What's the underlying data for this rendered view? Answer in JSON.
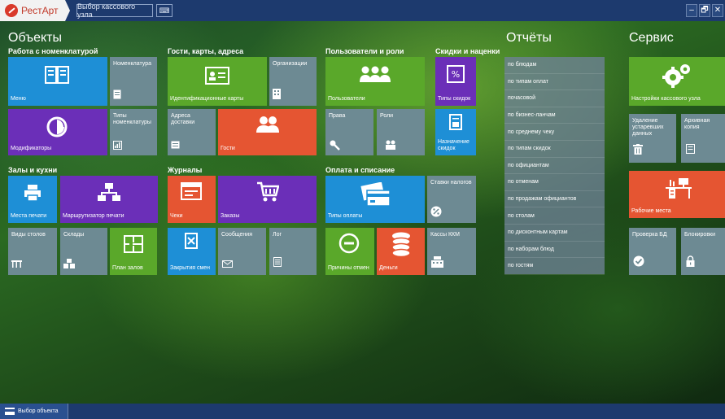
{
  "app": {
    "name": "РестАрт",
    "node_button": "Выбор кассового узла",
    "keyboard_button": "⌨"
  },
  "window_controls": {
    "minimize": "–",
    "restore": "🗗",
    "close": "✕"
  },
  "sections": {
    "objects": "Объекты",
    "reports": "Отчёты",
    "service": "Сервис"
  },
  "groups": {
    "nomenclature": "Работа с номенклатурой",
    "guests": "Гости, карты, адреса",
    "users": "Пользователи и роли",
    "discounts": "Скидки и наценки",
    "halls": "Залы и кухни",
    "journals": "Журналы",
    "payment": "Оплата и списание"
  },
  "tiles": {
    "menu": "Меню",
    "nomenclature": "Номенклатура",
    "modifiers": "Модификаторы",
    "nomenclature_types": "Типы номенклатуры",
    "id_cards": "Идентификационные карты",
    "organizations": "Организации",
    "delivery_addresses": "Адреса доставки",
    "guests": "Гости",
    "users": "Пользователи",
    "rights": "Права",
    "roles": "Роли",
    "discount_types": "Типы скидок",
    "discount_assign": "Назначение скидок",
    "print_places": "Места печати",
    "print_router": "Маршрутизатор печати",
    "table_types": "Виды столов",
    "warehouses": "Склады",
    "hall_plan": "План залов",
    "checks": "Чеки",
    "orders": "Заказы",
    "shift_close": "Закрытия смен",
    "messages": "Сообщения",
    "log": "Лог",
    "payment_types": "Типы оплаты",
    "tax_rates": "Ставки налогов",
    "cancel_reasons": "Причины отмен",
    "money": "Деньги",
    "kkm": "Кассы ККМ",
    "pos_settings": "Настройки кассового узла",
    "delete_old": "Удаление устаревших данных",
    "backup": "Архивная копия",
    "workplaces": "Рабочие места",
    "db_check": "Проверка БД",
    "locks": "Блокировки"
  },
  "reports": [
    "по блюдам",
    "по типам оплат",
    "почасовой",
    "по бизнес-ланчам",
    "по среднему чеку",
    "по типам скидок",
    "по официантам",
    "по отменам",
    "по продажам официантов",
    "по столам",
    "по дисконтным картам",
    "по наборам блюд",
    "по гостям"
  ],
  "bottom": {
    "select_object": "Выбор объекта"
  }
}
